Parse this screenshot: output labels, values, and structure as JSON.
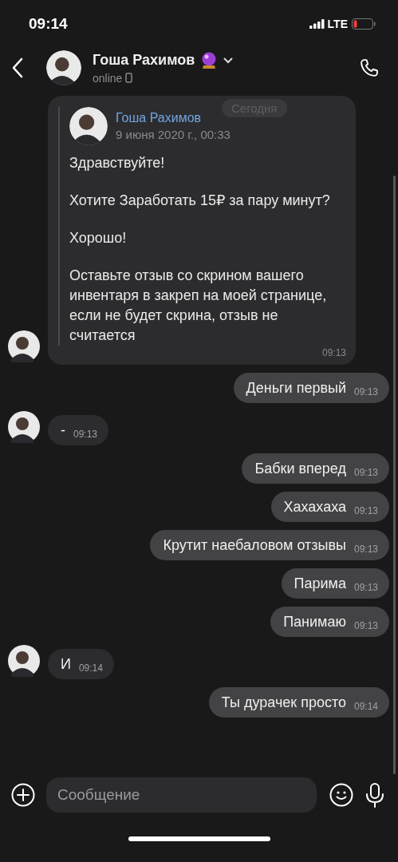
{
  "status_bar": {
    "time": "09:14",
    "network": "LTE"
  },
  "header": {
    "name": "Гоша Рахимов",
    "status": "online"
  },
  "date_pill": "Сегодня",
  "messages": [
    {
      "kind": "forward",
      "author": "Гоша Рахимов",
      "date": "9 июня 2020 г., 00:33",
      "paragraphs": [
        "Здравствуйте!",
        "Хотите Заработать 15₽ за пару минут?",
        "Хорошо!",
        "Оставьте отзыв со скрином вашего инвентаря в закреп на моей странице, если не будет скрина, отзыв не считается"
      ],
      "time": "09:13"
    },
    {
      "kind": "out",
      "text": "Деньги первый",
      "time": "09:13"
    },
    {
      "kind": "in",
      "text": "-",
      "time": "09:13"
    },
    {
      "kind": "out",
      "text": "Бабки вперед",
      "time": "09:13"
    },
    {
      "kind": "out",
      "text": "Хахахаха",
      "time": "09:13"
    },
    {
      "kind": "out",
      "text": "Крутит наебаловом отзывы",
      "time": "09:13"
    },
    {
      "kind": "out",
      "text": "Парима",
      "time": "09:13"
    },
    {
      "kind": "out",
      "text": "Панимаю",
      "time": "09:13"
    },
    {
      "kind": "in",
      "text": "И",
      "time": "09:14"
    },
    {
      "kind": "out",
      "text": "Ты дурачек просто",
      "time": "09:14"
    }
  ],
  "composer": {
    "placeholder": "Сообщение"
  }
}
